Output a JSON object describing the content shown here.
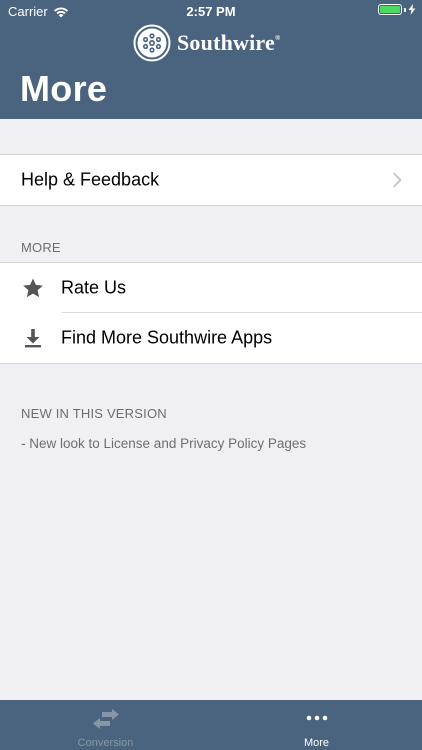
{
  "status_bar": {
    "carrier": "Carrier",
    "time": "2:57 PM",
    "battery_level": 1.0
  },
  "header": {
    "logo_text": "Southwire",
    "logo_mark": "®",
    "title": "More"
  },
  "colors": {
    "header_bg": "#4a6480",
    "page_bg": "#efeff4",
    "battery_green": "#4cd964",
    "secondary_text": "#6d6d72"
  },
  "help_group": {
    "help_label": "Help & Feedback",
    "help_icon": "chevron-right-icon"
  },
  "more_section": {
    "header": "MORE",
    "items": [
      {
        "label": "Rate Us",
        "icon": "star-icon"
      },
      {
        "label": "Find More Southwire Apps",
        "icon": "download-icon"
      }
    ]
  },
  "version_section": {
    "header": "NEW IN THIS VERSION",
    "note": "- New look to License and Privacy Policy Pages"
  },
  "tabbar": {
    "tabs": [
      {
        "label": "Conversion",
        "icon": "swap-arrows-icon",
        "selected": false
      },
      {
        "label": "More",
        "icon": "more-dots-icon",
        "selected": true
      }
    ]
  }
}
